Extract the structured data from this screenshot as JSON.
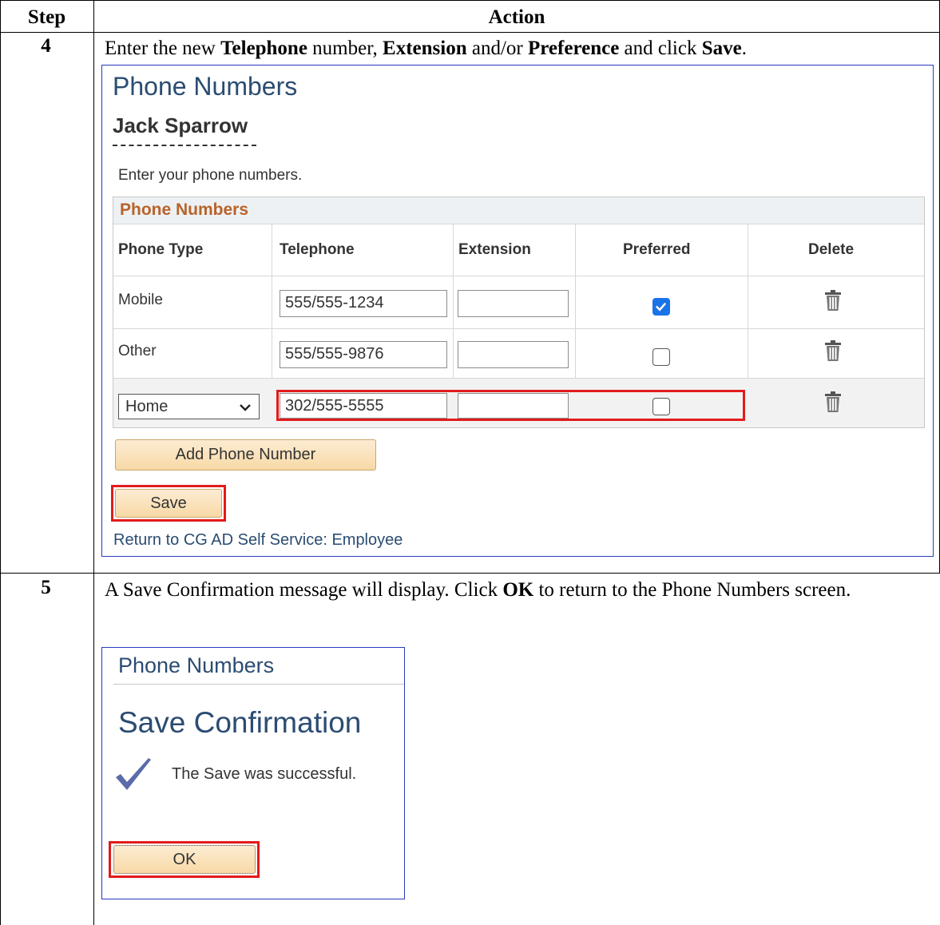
{
  "table": {
    "col_step": "Step",
    "col_action": "Action"
  },
  "step4": {
    "number": "4",
    "text_parts": [
      "Enter the new ",
      "Telephone",
      " number, ",
      "Extension",
      " and/or ",
      "Preference",
      " and click ",
      "Save",
      "."
    ],
    "screen": {
      "title": "Phone Numbers",
      "employee_name": "Jack Sparrow",
      "instruction": "Enter your phone numbers.",
      "grid_title": "Phone Numbers",
      "columns": [
        "Phone Type",
        "Telephone",
        "Extension",
        "Preferred",
        "Delete"
      ],
      "rows": [
        {
          "type": "Mobile",
          "telephone": "555/555-1234",
          "extension": "",
          "preferred": true
        },
        {
          "type": "Other",
          "telephone": "555/555-9876",
          "extension": "",
          "preferred": false
        }
      ],
      "new_row": {
        "type_selected": "Home",
        "telephone": "302/555-5555",
        "extension": "",
        "preferred": false
      },
      "add_button": "Add Phone Number",
      "save_button": "Save",
      "return_link": "Return to CG AD Self Service: Employee"
    }
  },
  "step5": {
    "number": "5",
    "text_parts": [
      "A Save Confirmation message will display. Click ",
      "OK",
      " to return to the Phone Numbers screen."
    ],
    "screen": {
      "title": "Phone Numbers",
      "heading": "Save Confirmation",
      "message": "The Save was successful.",
      "ok_button": "OK"
    }
  },
  "colors": {
    "border_blue": "#2a3bbf",
    "title_blue": "#2b4c72",
    "grid_title_orange": "#b8632a",
    "highlight_red": "#e21b1b",
    "check_blue": "#1a73e8",
    "confirm_check": "#5b6aa8"
  }
}
